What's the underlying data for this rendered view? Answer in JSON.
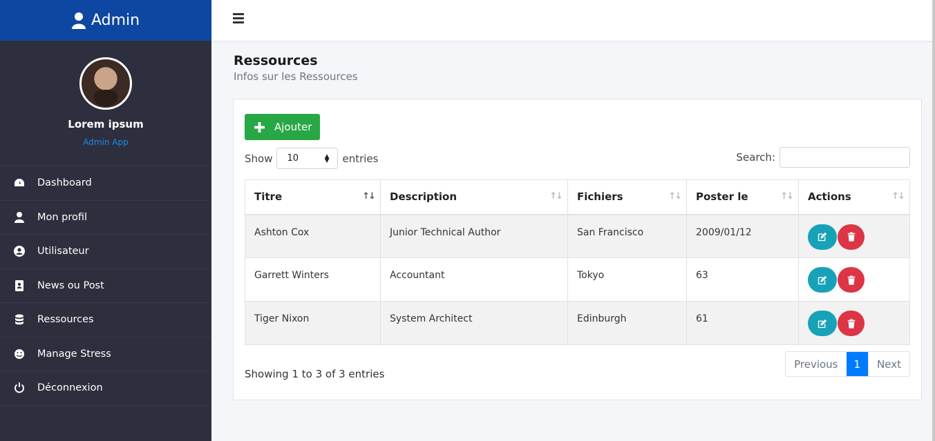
{
  "brand": {
    "title": "Admin",
    "icon": "user-icon"
  },
  "profile": {
    "name": "Lorem ipsum",
    "role": "Admin App"
  },
  "nav": [
    {
      "label": "Dashboard",
      "icon": "dashboard-icon"
    },
    {
      "label": "Mon profil",
      "icon": "user-icon"
    },
    {
      "label": "Utilisateur",
      "icon": "user-circle-icon"
    },
    {
      "label": "News ou Post",
      "icon": "address-book-icon"
    },
    {
      "label": "Ressources",
      "icon": "database-icon"
    },
    {
      "label": "Manage Stress",
      "icon": "smile-icon"
    },
    {
      "label": "Déconnexion",
      "icon": "power-icon"
    }
  ],
  "page": {
    "title": "Ressources",
    "subtitle": "Infos sur les Ressources"
  },
  "toolbar": {
    "add_label": "Ajouter"
  },
  "length": {
    "show": "Show",
    "value": "10",
    "entries": "entries"
  },
  "search": {
    "label": "Search:",
    "value": ""
  },
  "table": {
    "headers": [
      "Titre",
      "Description",
      "Fichiers",
      "Poster le",
      "Actions"
    ],
    "rows": [
      [
        "Ashton Cox",
        "Junior Technical Author",
        "San Francisco",
        "2009/01/12"
      ],
      [
        "Garrett Winters",
        "Accountant",
        "Tokyo",
        "63"
      ],
      [
        "Tiger Nixon",
        "System Architect",
        "Edinburgh",
        "61"
      ]
    ]
  },
  "footer": {
    "info": "Showing 1 to 3 of 3 entries",
    "previous": "Previous",
    "current_page": "1",
    "next": "Next"
  },
  "colors": {
    "sidebar": "#2e2f3e",
    "brand": "#0d47a1",
    "add": "#28a745",
    "edit": "#17a2b8",
    "delete": "#dc3545",
    "page_active": "#007bff"
  }
}
